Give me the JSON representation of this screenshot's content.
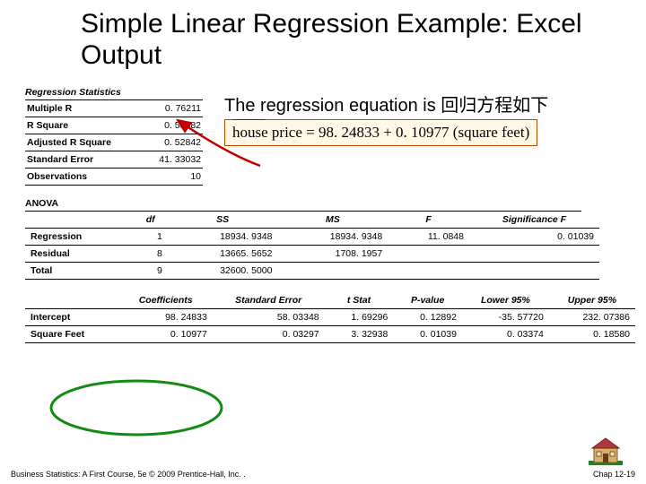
{
  "title": "Simple Linear Regression Example:  Excel Output",
  "stats_heading": "Regression Statistics",
  "stats": {
    "rows": [
      {
        "label": "Multiple R",
        "val": "0. 76211"
      },
      {
        "label": "R Square",
        "val": "0. 58082"
      },
      {
        "label": "Adjusted R Square",
        "val": "0. 52842"
      },
      {
        "label": "Standard Error",
        "val": "41. 33032"
      },
      {
        "label": "Observations",
        "val": "10"
      }
    ]
  },
  "annot_text": "The regression equation is 回归方程如下",
  "equation_text": "house price = 98. 24833 + 0. 10977 (square feet)",
  "anova_heading": "ANOVA",
  "anova": {
    "headers": [
      "",
      "df",
      "SS",
      "MS",
      "F",
      "Significance F"
    ],
    "rows": [
      [
        "Regression",
        "1",
        "18934. 9348",
        "18934. 9348",
        "11. 0848",
        "0. 01039"
      ],
      [
        "Residual",
        "8",
        "13665. 5652",
        "1708. 1957",
        "",
        ""
      ],
      [
        "Total",
        "9",
        "32600. 5000",
        "",
        "",
        ""
      ]
    ]
  },
  "coef": {
    "headers": [
      "",
      "Coefficients",
      "Standard Error",
      "t Stat",
      "P-value",
      "Lower 95%",
      "Upper 95%"
    ],
    "rows": [
      [
        "Intercept",
        "98. 24833",
        "58. 03348",
        "1. 69296",
        "0. 12892",
        "-35. 57720",
        "232. 07386"
      ],
      [
        "Square Feet",
        "0. 10977",
        "0. 03297",
        "3. 32938",
        "0. 01039",
        "0. 03374",
        "0. 18580"
      ]
    ]
  },
  "footer_left": "Business Statistics: A First Course, 5e © 2009 Prentice-Hall, Inc. .",
  "footer_right": "Chap 12-19",
  "chart_data": {
    "type": "table",
    "title": "Simple Linear Regression Excel Output",
    "regression_statistics": {
      "Multiple R": 0.76211,
      "R Square": 0.58082,
      "Adjusted R Square": 0.52842,
      "Standard Error": 41.33032,
      "Observations": 10
    },
    "anova": {
      "Regression": {
        "df": 1,
        "SS": 18934.9348,
        "MS": 18934.9348,
        "F": 11.0848,
        "Significance F": 0.01039
      },
      "Residual": {
        "df": 8,
        "SS": 13665.5652,
        "MS": 1708.1957
      },
      "Total": {
        "df": 9,
        "SS": 32600.5
      }
    },
    "coefficients": {
      "Intercept": {
        "coef": 98.24833,
        "se": 58.03348,
        "t": 1.69296,
        "p": 0.12892,
        "lower95": -35.5772,
        "upper95": 232.07386
      },
      "Square Feet": {
        "coef": 0.10977,
        "se": 0.03297,
        "t": 3.32938,
        "p": 0.01039,
        "lower95": 0.03374,
        "upper95": 0.1858
      }
    },
    "equation": "house_price_hat = 98.24833 + 0.10977 * square_feet"
  }
}
